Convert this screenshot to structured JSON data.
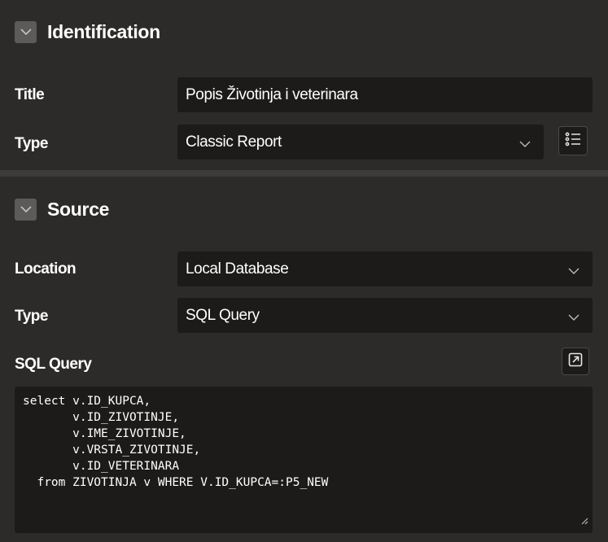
{
  "identification": {
    "section_title": "Identification",
    "toggle_icon": "chevron-down-icon",
    "title_label": "Title",
    "title_value": "Popis Životinja i veterinara",
    "type_label": "Type",
    "type_value": "Classic Report",
    "type_options_icon": "list-options-icon"
  },
  "source": {
    "section_title": "Source",
    "toggle_icon": "chevron-down-icon",
    "location_label": "Location",
    "location_value": "Local Database",
    "type_label": "Type",
    "type_value": "SQL Query",
    "sql_label": "SQL Query",
    "expand_icon": "expand-editor-icon",
    "sql_code": "select v.ID_KUPCA,\n       v.ID_ZIVOTINJE,\n       v.IME_ZIVOTINJE,\n       v.VRSTA_ZIVOTINJE,\n       v.ID_VETERINARA\n  from ZIVOTINJA v WHERE V.ID_KUPCA=:P5_NEW"
  },
  "colors": {
    "background": "#2d2b29",
    "field_background": "#1c1b1a",
    "toggle_background": "#5c5b59",
    "divider": "#3d3b39"
  }
}
